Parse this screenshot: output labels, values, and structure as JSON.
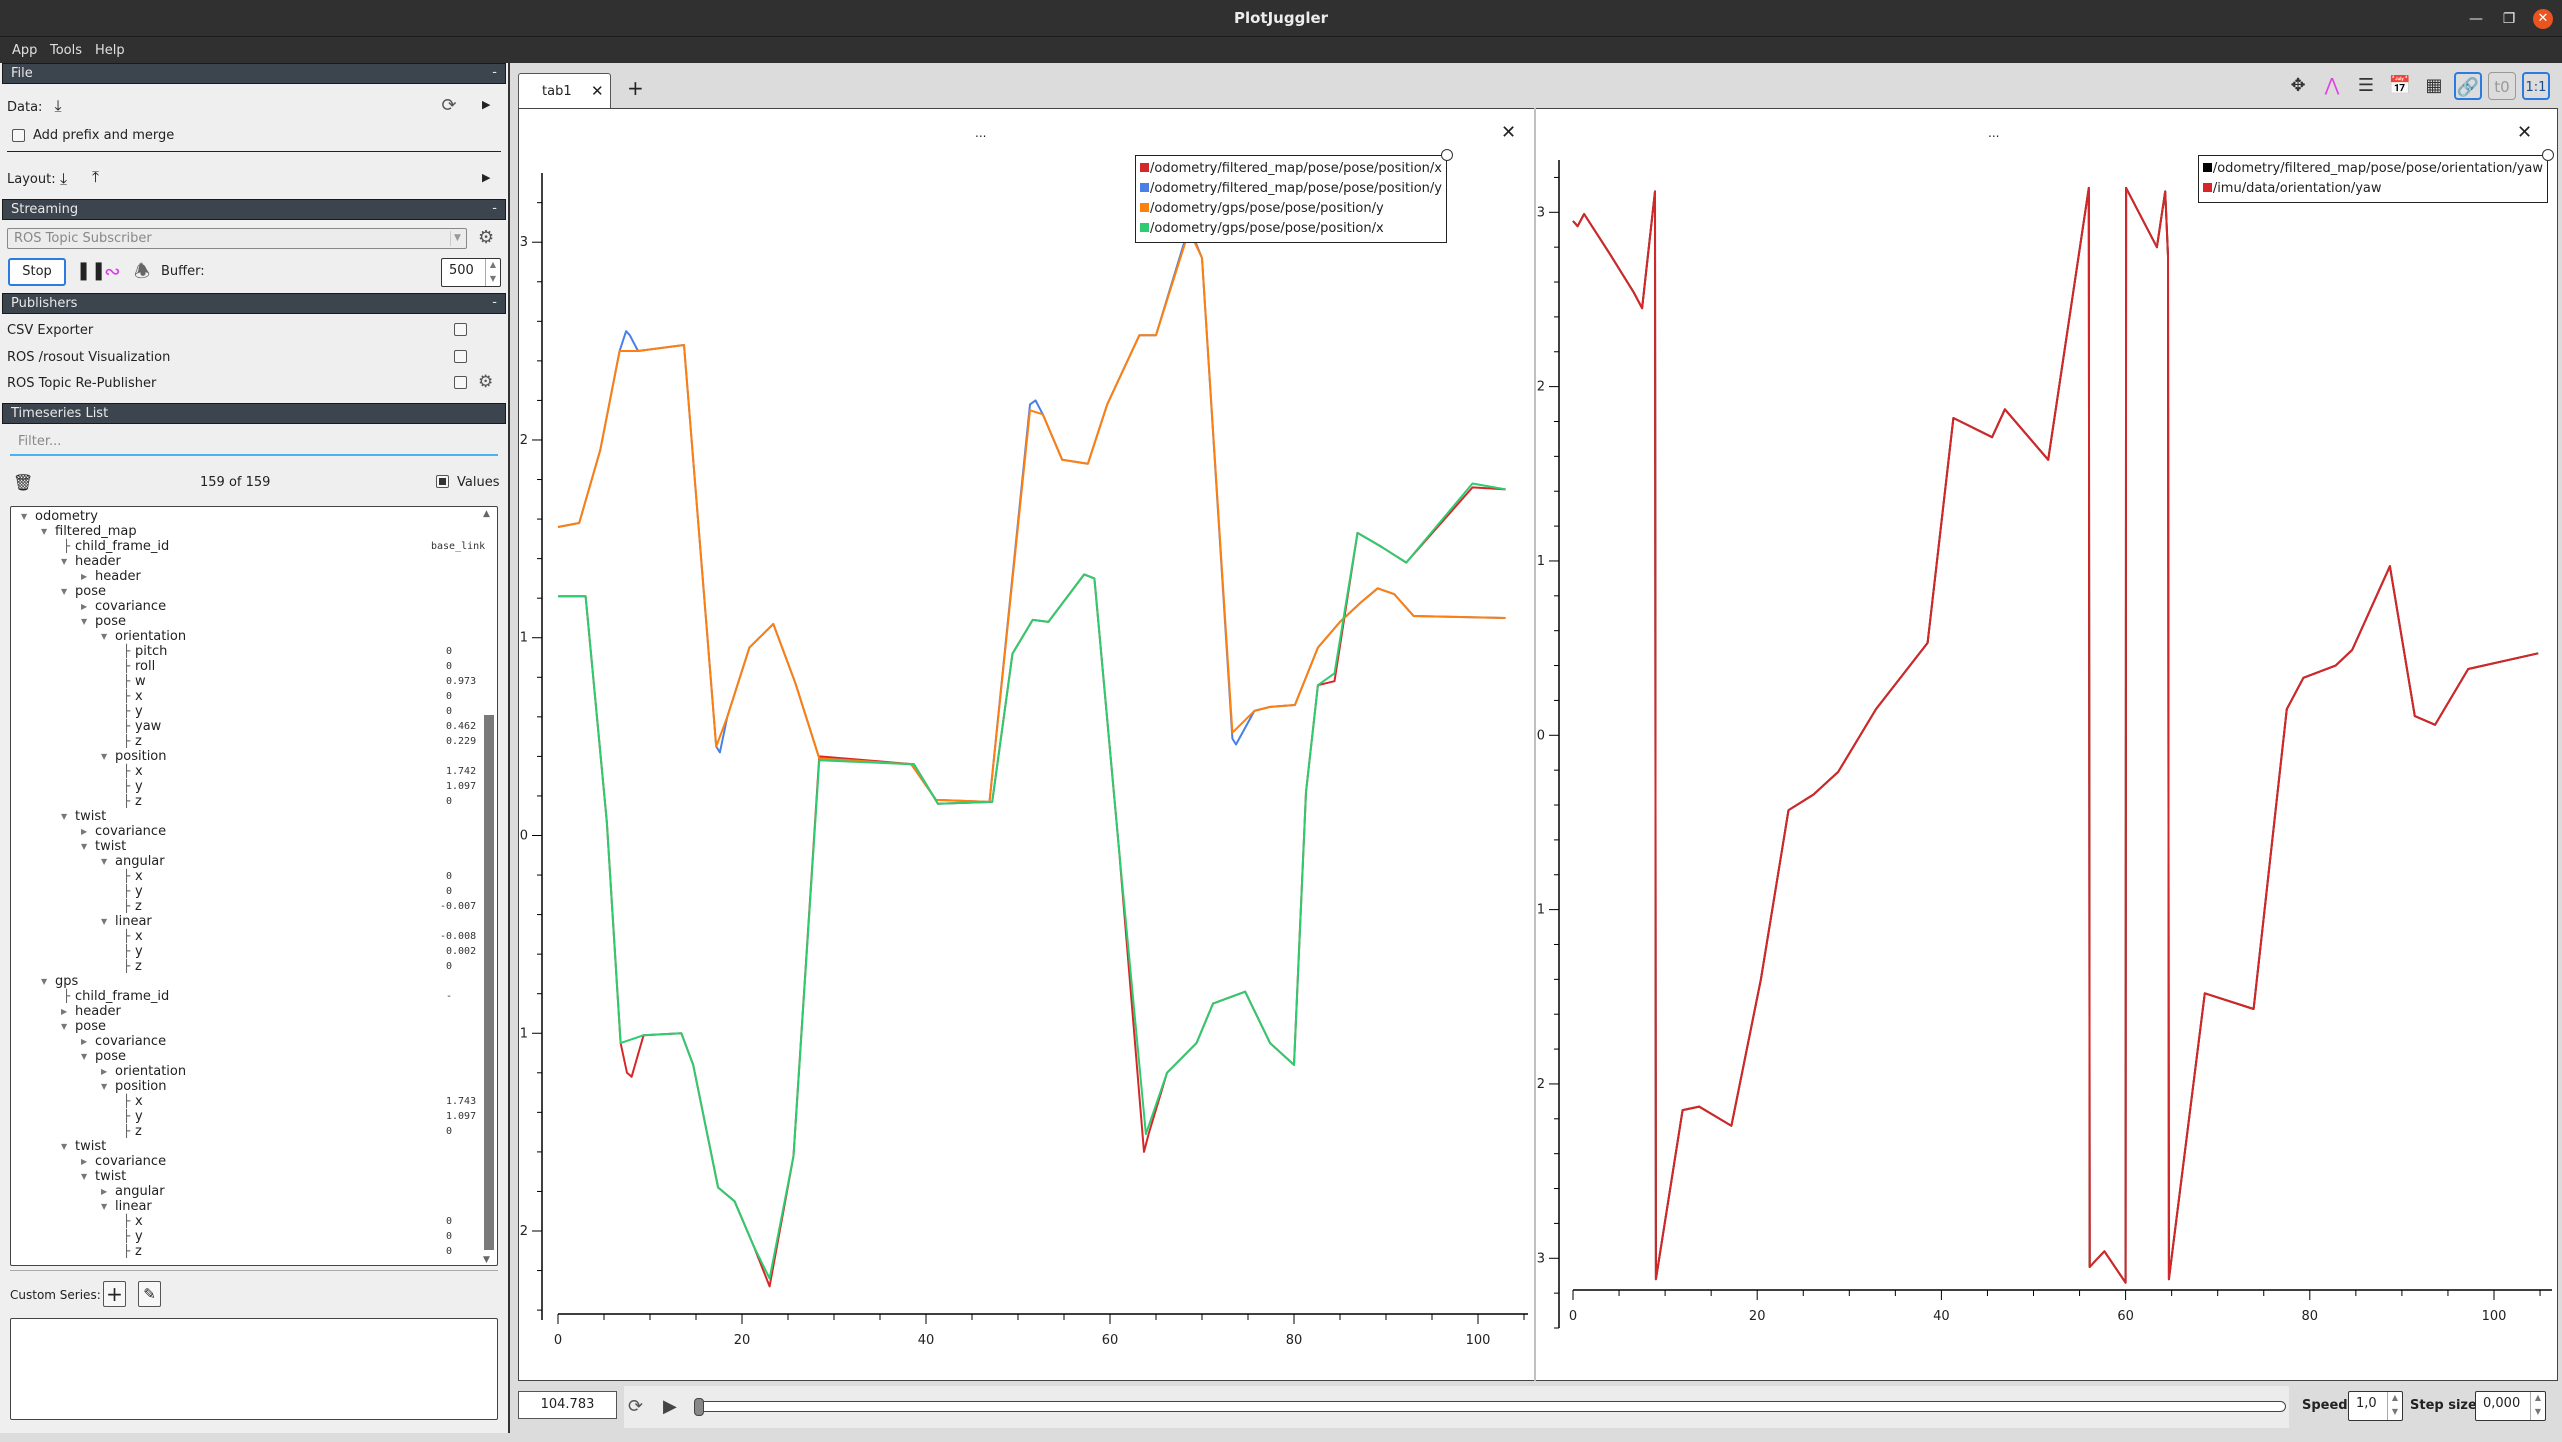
{
  "window": {
    "title": "PlotJuggler"
  },
  "menu": [
    "App",
    "Tools",
    "Help"
  ],
  "sidebar": {
    "file": {
      "header": "File",
      "collapse": "-",
      "data_label": "Data:",
      "add_prefix_label": "Add prefix and merge",
      "add_prefix_checked": false,
      "layout_label": "Layout:"
    },
    "streaming": {
      "header": "Streaming",
      "collapse": "-",
      "source": "ROS Topic Subscriber",
      "stop_label": "Stop",
      "buffer_label": "Buffer:",
      "buffer_value": "500"
    },
    "publishers": {
      "header": "Publishers",
      "collapse": "-",
      "items": [
        {
          "label": "CSV Exporter",
          "checked": false,
          "has_settings": false
        },
        {
          "label": "ROS /rosout Visualization",
          "checked": false,
          "has_settings": false
        },
        {
          "label": "ROS Topic Re-Publisher",
          "checked": false,
          "has_settings": true
        }
      ]
    },
    "timeseries": {
      "header": "Timeseries List",
      "filter_placeholder": "Filter...",
      "count": "159 of 159",
      "values_label": "Values",
      "values_checked": true,
      "tree": [
        {
          "name": "odometry",
          "depth": 0,
          "toggle": "open",
          "value": ""
        },
        {
          "name": "filtered_map",
          "depth": 1,
          "toggle": "open",
          "value": ""
        },
        {
          "name": "child_frame_id",
          "depth": 2,
          "toggle": "leaf",
          "value": "base_link"
        },
        {
          "name": "header",
          "depth": 2,
          "toggle": "open",
          "value": ""
        },
        {
          "name": "header",
          "depth": 3,
          "toggle": "closed",
          "value": ""
        },
        {
          "name": "pose",
          "depth": 2,
          "toggle": "open",
          "value": ""
        },
        {
          "name": "covariance",
          "depth": 3,
          "toggle": "closed",
          "value": ""
        },
        {
          "name": "pose",
          "depth": 3,
          "toggle": "open",
          "value": ""
        },
        {
          "name": "orientation",
          "depth": 4,
          "toggle": "open",
          "value": ""
        },
        {
          "name": "pitch",
          "depth": 5,
          "toggle": "leaf",
          "value": "0"
        },
        {
          "name": "roll",
          "depth": 5,
          "toggle": "leaf",
          "value": "0"
        },
        {
          "name": "w",
          "depth": 5,
          "toggle": "leaf",
          "value": "0.973"
        },
        {
          "name": "x",
          "depth": 5,
          "toggle": "leaf",
          "value": "0"
        },
        {
          "name": "y",
          "depth": 5,
          "toggle": "leaf",
          "value": "0"
        },
        {
          "name": "yaw",
          "depth": 5,
          "toggle": "leaf",
          "value": "0.462"
        },
        {
          "name": "z",
          "depth": 5,
          "toggle": "leaf",
          "value": "0.229"
        },
        {
          "name": "position",
          "depth": 4,
          "toggle": "open",
          "value": ""
        },
        {
          "name": "x",
          "depth": 5,
          "toggle": "leaf",
          "value": "1.742"
        },
        {
          "name": "y",
          "depth": 5,
          "toggle": "leaf",
          "value": "1.097"
        },
        {
          "name": "z",
          "depth": 5,
          "toggle": "leaf",
          "value": "0"
        },
        {
          "name": "twist",
          "depth": 2,
          "toggle": "open",
          "value": ""
        },
        {
          "name": "covariance",
          "depth": 3,
          "toggle": "closed",
          "value": ""
        },
        {
          "name": "twist",
          "depth": 3,
          "toggle": "open",
          "value": ""
        },
        {
          "name": "angular",
          "depth": 4,
          "toggle": "open",
          "value": ""
        },
        {
          "name": "x",
          "depth": 5,
          "toggle": "leaf",
          "value": "0"
        },
        {
          "name": "y",
          "depth": 5,
          "toggle": "leaf",
          "value": "0"
        },
        {
          "name": "z",
          "depth": 5,
          "toggle": "leaf",
          "value": "-0.007"
        },
        {
          "name": "linear",
          "depth": 4,
          "toggle": "open",
          "value": ""
        },
        {
          "name": "x",
          "depth": 5,
          "toggle": "leaf",
          "value": "-0.008"
        },
        {
          "name": "y",
          "depth": 5,
          "toggle": "leaf",
          "value": "0.002"
        },
        {
          "name": "z",
          "depth": 5,
          "toggle": "leaf",
          "value": "0"
        },
        {
          "name": "gps",
          "depth": 1,
          "toggle": "open",
          "value": ""
        },
        {
          "name": "child_frame_id",
          "depth": 2,
          "toggle": "leaf",
          "value": "-"
        },
        {
          "name": "header",
          "depth": 2,
          "toggle": "closed",
          "value": ""
        },
        {
          "name": "pose",
          "depth": 2,
          "toggle": "open",
          "value": ""
        },
        {
          "name": "covariance",
          "depth": 3,
          "toggle": "closed",
          "value": ""
        },
        {
          "name": "pose",
          "depth": 3,
          "toggle": "open",
          "value": ""
        },
        {
          "name": "orientation",
          "depth": 4,
          "toggle": "closed",
          "value": ""
        },
        {
          "name": "position",
          "depth": 4,
          "toggle": "open",
          "value": ""
        },
        {
          "name": "x",
          "depth": 5,
          "toggle": "leaf",
          "value": "1.743"
        },
        {
          "name": "y",
          "depth": 5,
          "toggle": "leaf",
          "value": "1.097"
        },
        {
          "name": "z",
          "depth": 5,
          "toggle": "leaf",
          "value": "0"
        },
        {
          "name": "twist",
          "depth": 2,
          "toggle": "open",
          "value": ""
        },
        {
          "name": "covariance",
          "depth": 3,
          "toggle": "closed",
          "value": ""
        },
        {
          "name": "twist",
          "depth": 3,
          "toggle": "open",
          "value": ""
        },
        {
          "name": "angular",
          "depth": 4,
          "toggle": "closed",
          "value": ""
        },
        {
          "name": "linear",
          "depth": 4,
          "toggle": "open",
          "value": ""
        },
        {
          "name": "x",
          "depth": 5,
          "toggle": "leaf",
          "value": "0"
        },
        {
          "name": "y",
          "depth": 5,
          "toggle": "leaf",
          "value": "0"
        },
        {
          "name": "z",
          "depth": 5,
          "toggle": "leaf",
          "value": "0"
        }
      ]
    },
    "custom_series_label": "Custom Series:"
  },
  "tabs": [
    {
      "label": "tab1",
      "active": true
    }
  ],
  "add_tab": "+",
  "toolbar": [
    "move-icon",
    "timeline-icon",
    "list-icon",
    "calendar-clock-icon",
    "grid-icon",
    "link-icon",
    "t0-icon",
    "ratio-1-1-icon"
  ],
  "toolbar_ratio_label": "1:1",
  "toolbar_t0_label": "t0",
  "plot_menu": "...",
  "playback": {
    "time": "104.783",
    "progress": 0.0,
    "speed_label": "Speed:",
    "speed_value": "1,0",
    "step_label": "Step size:",
    "step_value": "0,000"
  },
  "chart_data": [
    {
      "type": "line",
      "title": "",
      "xlabel": "",
      "ylabel": "",
      "xlim": [
        0,
        105
      ],
      "ylim": [
        -2.45,
        3.35
      ],
      "xticks": [
        0,
        20,
        40,
        60,
        80,
        100
      ],
      "yticks": [
        -2,
        -1,
        0,
        1,
        2,
        3
      ],
      "grid": false,
      "legend_position": "top-right",
      "series": [
        {
          "name": "/odometry/filtered_map/pose/pose/position/x",
          "color": "#d62728",
          "x": [
            0,
            3,
            5.3,
            6.8,
            7.5,
            8,
            9.3,
            13.4,
            14.7,
            17.4,
            19.2,
            21.3,
            23,
            25.6,
            28.4,
            38.7,
            41.3,
            47.2,
            49.4,
            51.6,
            53.3,
            57.2,
            58.3,
            61,
            63.7,
            64.2,
            66.2,
            69.4,
            71.2,
            74.7,
            77.4,
            80,
            81.3,
            82.6,
            84.4,
            86.9,
            89.5,
            92.2,
            99.4,
            103
          ],
          "y": [
            1.21,
            1.21,
            0.07,
            -1.05,
            -1.2,
            -1.22,
            -1.01,
            -1.0,
            -1.16,
            -1.78,
            -1.85,
            -2.08,
            -2.28,
            -1.62,
            0.4,
            0.36,
            0.16,
            0.17,
            0.92,
            1.09,
            1.08,
            1.32,
            1.3,
            -0.08,
            -1.6,
            -1.51,
            -1.2,
            -1.05,
            -0.85,
            -0.79,
            -1.05,
            -1.16,
            0.22,
            0.76,
            0.78,
            1.53,
            1.46,
            1.38,
            1.76,
            1.75
          ]
        },
        {
          "name": "/odometry/filtered_map/pose/pose/position/y",
          "color": "#4a7fe8",
          "x": [
            0,
            2.3,
            4.6,
            6.7,
            7.4,
            7.8,
            8.7,
            13.7,
            17.2,
            17.6,
            18.4,
            20.8,
            23.4,
            25.8,
            28.4,
            38.4,
            41.1,
            46.9,
            51.3,
            51.9,
            52.7,
            54.8,
            57.6,
            59.7,
            63.2,
            65,
            68.6,
            70,
            73.3,
            73.7,
            75.7,
            77.4,
            80.1,
            82.6,
            85,
            87.3,
            89.1,
            90.9,
            93,
            103
          ],
          "y": [
            1.56,
            1.58,
            1.95,
            2.45,
            2.55,
            2.53,
            2.45,
            2.48,
            0.45,
            0.42,
            0.6,
            0.95,
            1.07,
            0.77,
            0.39,
            0.36,
            0.18,
            0.17,
            2.18,
            2.2,
            2.13,
            1.9,
            1.88,
            2.18,
            2.53,
            2.53,
            3.08,
            2.92,
            0.49,
            0.46,
            0.63,
            0.65,
            0.66,
            0.95,
            1.08,
            1.18,
            1.25,
            1.22,
            1.11,
            1.1
          ]
        },
        {
          "name": "/odometry/gps/pose/pose/position/y",
          "color": "#ff7f0e",
          "x": [
            0,
            2.3,
            4.6,
            6.7,
            8.7,
            13.7,
            17.2,
            18.4,
            20.8,
            23.4,
            25.8,
            28.4,
            38.4,
            41.1,
            46.9,
            51.3,
            52.7,
            54.8,
            57.6,
            59.7,
            63.2,
            65,
            68.6,
            70,
            73.3,
            75.7,
            77.4,
            80.1,
            82.6,
            85,
            87.3,
            89.1,
            90.9,
            93,
            103
          ],
          "y": [
            1.56,
            1.58,
            1.95,
            2.45,
            2.45,
            2.48,
            0.45,
            0.6,
            0.95,
            1.07,
            0.77,
            0.39,
            0.36,
            0.18,
            0.17,
            2.15,
            2.13,
            1.9,
            1.88,
            2.18,
            2.53,
            2.53,
            3.06,
            2.92,
            0.52,
            0.63,
            0.65,
            0.66,
            0.95,
            1.08,
            1.18,
            1.25,
            1.22,
            1.11,
            1.1
          ]
        },
        {
          "name": "/odometry/gps/pose/pose/position/x",
          "color": "#2ecc71",
          "x": [
            0,
            3,
            5.3,
            6.8,
            9.3,
            13.4,
            14.7,
            17.4,
            19.2,
            21.3,
            23,
            25.6,
            28.4,
            38.7,
            41.3,
            47.2,
            49.4,
            51.6,
            53.3,
            57.2,
            58.3,
            61,
            63.9,
            66.2,
            69.4,
            71.2,
            74.7,
            77.4,
            80,
            81.3,
            82.6,
            84.4,
            86.9,
            89.5,
            92.2,
            99.4,
            103
          ],
          "y": [
            1.21,
            1.21,
            0.07,
            -1.05,
            -1.01,
            -1.0,
            -1.16,
            -1.78,
            -1.85,
            -2.08,
            -2.24,
            -1.62,
            0.38,
            0.36,
            0.16,
            0.17,
            0.92,
            1.09,
            1.08,
            1.32,
            1.3,
            -0.08,
            -1.51,
            -1.2,
            -1.05,
            -0.85,
            -0.79,
            -1.05,
            -1.16,
            0.22,
            0.76,
            0.82,
            1.53,
            1.46,
            1.38,
            1.78,
            1.75
          ]
        }
      ]
    },
    {
      "type": "line",
      "title": "",
      "xlabel": "",
      "ylabel": "",
      "xlim": [
        0,
        105
      ],
      "ylim": [
        -3.4,
        3.3
      ],
      "xticks": [
        0,
        20,
        40,
        60,
        80,
        100
      ],
      "yticks": [
        -3,
        -2,
        -1,
        0,
        1,
        2,
        3
      ],
      "grid": false,
      "legend_position": "top-right",
      "series": [
        {
          "name": "/odometry/filtered_map/pose/pose/orientation/yaw",
          "color": "#000000",
          "x": [
            0,
            0.5,
            1.2,
            3.9,
            6.6,
            7.5,
            8.9,
            9.0,
            11.9,
            13.7,
            17.2,
            20.4,
            23.4,
            26.1,
            28.8,
            32.9,
            38.5,
            41.3,
            45.5,
            46.9,
            51.6,
            56.0,
            56.1,
            56.8,
            57.7,
            60.0,
            60.05,
            63.4,
            64.3,
            64.6,
            64.7,
            68.6,
            73.9,
            77.5,
            79.3,
            82.8,
            84.6,
            88.7,
            91.4,
            93.6,
            97.2,
            104.8
          ],
          "y": [
            2.95,
            2.92,
            2.99,
            2.77,
            2.54,
            2.45,
            3.12,
            -3.12,
            -2.15,
            -2.13,
            -2.24,
            -1.4,
            -0.43,
            -0.34,
            -0.21,
            0.15,
            0.53,
            1.82,
            1.71,
            1.87,
            1.58,
            3.14,
            -3.05,
            -3.01,
            -2.96,
            -3.14,
            3.14,
            2.8,
            3.12,
            2.75,
            -3.12,
            -1.48,
            -1.57,
            0.15,
            0.33,
            0.4,
            0.49,
            0.97,
            0.11,
            0.06,
            0.38,
            0.47
          ]
        },
        {
          "name": "/imu/data/orientation/yaw",
          "color": "#d62728",
          "x": [
            0,
            0.5,
            1.2,
            3.9,
            6.6,
            7.5,
            8.9,
            9.0,
            11.9,
            13.7,
            17.2,
            20.4,
            23.4,
            26.1,
            28.8,
            32.9,
            38.5,
            41.3,
            45.5,
            46.9,
            51.6,
            56.0,
            56.1,
            56.8,
            57.7,
            60.0,
            60.05,
            63.4,
            64.3,
            64.6,
            64.7,
            68.6,
            73.9,
            77.5,
            79.3,
            82.8,
            84.6,
            88.7,
            91.4,
            93.6,
            97.2,
            104.8
          ],
          "y": [
            2.95,
            2.92,
            2.99,
            2.77,
            2.54,
            2.45,
            3.12,
            -3.12,
            -2.15,
            -2.13,
            -2.24,
            -1.4,
            -0.43,
            -0.34,
            -0.21,
            0.15,
            0.53,
            1.82,
            1.71,
            1.87,
            1.58,
            3.14,
            -3.05,
            -3.01,
            -2.96,
            -3.14,
            3.14,
            2.8,
            3.12,
            2.75,
            -3.12,
            -1.48,
            -1.57,
            0.15,
            0.33,
            0.4,
            0.49,
            0.97,
            0.11,
            0.06,
            0.38,
            0.47
          ]
        }
      ]
    }
  ]
}
